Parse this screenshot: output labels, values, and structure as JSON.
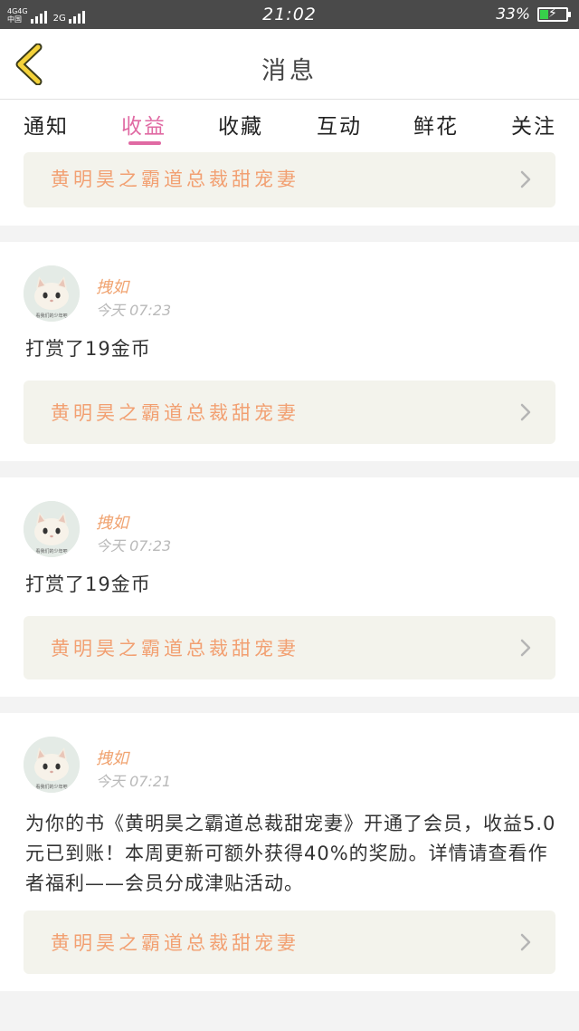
{
  "status_bar": {
    "network_top": "4G4G",
    "network_bottom": "中国",
    "network2": "2G",
    "time": "21:02",
    "battery_pct": "33%",
    "battery_level": 0.33,
    "battery_color": "#37d04a"
  },
  "header": {
    "title": "消息"
  },
  "tabs": [
    {
      "label": "通知",
      "active": false
    },
    {
      "label": "收益",
      "active": true
    },
    {
      "label": "收藏",
      "active": false
    },
    {
      "label": "互动",
      "active": false
    },
    {
      "label": "鲜花",
      "active": false
    },
    {
      "label": "关注",
      "active": false
    }
  ],
  "accent_color": "#e06aa3",
  "book_color": "#f2a072",
  "top_card": {
    "book_title": "黄明昊之霸道总裁甜宠妻"
  },
  "messages": [
    {
      "avatar_caption": "看我们的少年吧",
      "username": "拽如",
      "time": "今天 07:23",
      "text": "打赏了19金币",
      "book_title": "黄明昊之霸道总裁甜宠妻"
    },
    {
      "avatar_caption": "看我们的少年吧",
      "username": "拽如",
      "time": "今天 07:23",
      "text": "打赏了19金币",
      "book_title": "黄明昊之霸道总裁甜宠妻"
    },
    {
      "avatar_caption": "看我们的少年吧",
      "username": "拽如",
      "time": "今天 07:21",
      "text": "为你的书《黄明昊之霸道总裁甜宠妻》开通了会员，收益5.0元已到账！本周更新可额外获得40%的奖励。详情请查看作者福利——会员分成津贴活动。",
      "book_title": "黄明昊之霸道总裁甜宠妻"
    }
  ]
}
